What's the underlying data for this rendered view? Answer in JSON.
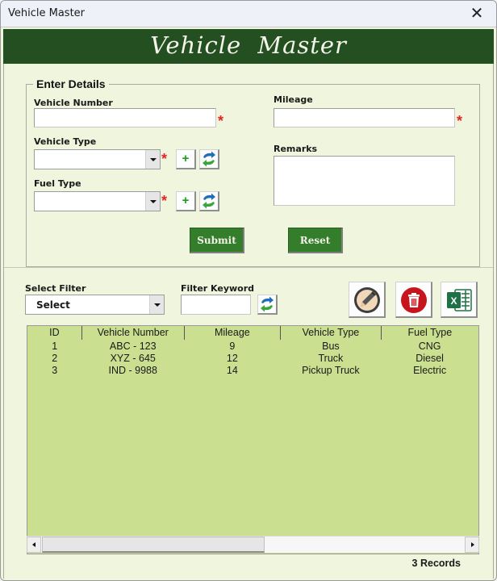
{
  "window": {
    "title": "Vehicle  Master",
    "close_label": "✕"
  },
  "banner": {
    "title": "Vehicle  Master"
  },
  "details": {
    "legend": "Enter Details",
    "vehicle_number": {
      "label": "Vehicle Number",
      "value": "",
      "required_mark": "*"
    },
    "vehicle_type": {
      "label": "Vehicle Type",
      "value": "",
      "required_mark": "*",
      "add_label": "+"
    },
    "fuel_type": {
      "label": "Fuel Type",
      "value": "",
      "required_mark": "*",
      "add_label": "+"
    },
    "mileage": {
      "label": "Mileage",
      "value": "",
      "required_mark": "*"
    },
    "remarks": {
      "label": "Remarks",
      "value": ""
    },
    "submit_label": "Submit",
    "reset_label": "Reset"
  },
  "filter": {
    "select_label": "Select Filter",
    "select_value": "Select",
    "keyword_label": "Filter Keyword",
    "keyword_value": ""
  },
  "actions": {
    "edit_icon": "pencil-icon",
    "delete_icon": "trash-icon",
    "excel_icon": "excel-icon"
  },
  "table": {
    "columns": [
      "ID",
      "Vehicle Number",
      "Mileage",
      "Vehicle Type",
      "Fuel Type"
    ],
    "rows": [
      [
        "1",
        "ABC - 123",
        "9",
        "Bus",
        "CNG"
      ],
      [
        "2",
        "XYZ - 645",
        "12",
        "Truck",
        "Diesel"
      ],
      [
        "3",
        "IND - 9988",
        "14",
        "Pickup Truck",
        "Electric"
      ]
    ]
  },
  "status": {
    "records": "3 Records"
  },
  "colors": {
    "banner": "#244f20",
    "background": "#f0f5dd",
    "button_green": "#347d2b",
    "grid_bg": "#cadf8f",
    "required": "#e22525"
  }
}
